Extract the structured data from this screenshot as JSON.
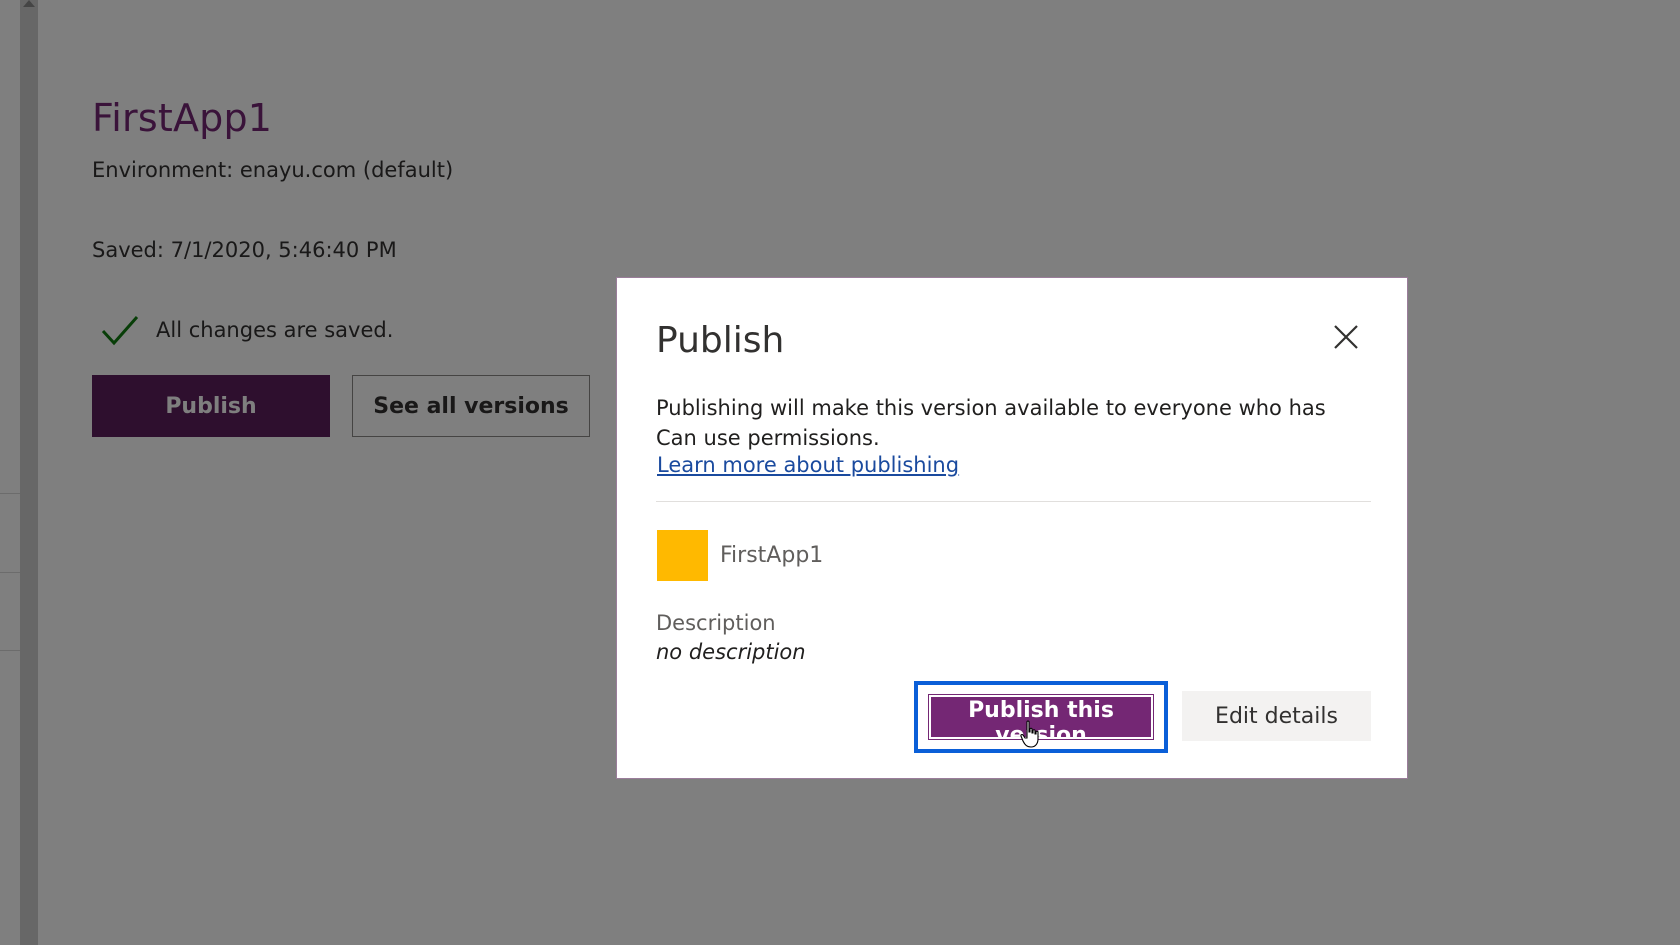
{
  "app": {
    "title": "FirstApp1",
    "environment": "Environment: enayu.com (default)",
    "saved": "Saved: 7/1/2020, 5:46:40 PM",
    "status": "All changes are saved.",
    "publish_label": "Publish",
    "versions_label": "See all versions"
  },
  "dialog": {
    "title": "Publish",
    "body": "Publishing will make this version available to everyone who has Can use permissions.",
    "link": "Learn more about publishing",
    "app_name": "FirstApp1",
    "description_label": "Description",
    "description_value": "no description",
    "primary_label": "Publish this version",
    "secondary_label": "Edit details"
  },
  "colors": {
    "brand_purple": "#742774",
    "app_tile": "#ffb900",
    "focus_blue": "#0a5fd8",
    "check_green": "#107c10"
  },
  "icons": {
    "status": "checkmark-icon",
    "close": "close-icon",
    "cursor": "hand-cursor-icon"
  }
}
